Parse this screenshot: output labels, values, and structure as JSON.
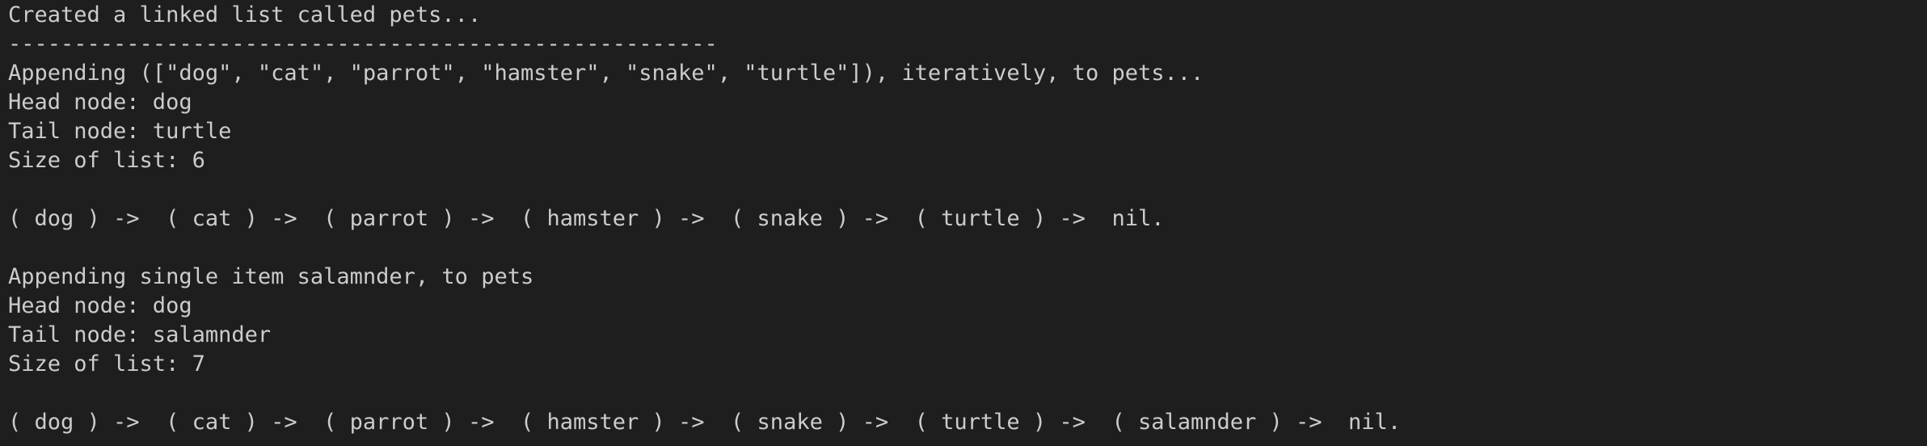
{
  "terminal": {
    "lines": [
      "Created a linked list called pets...",
      "------------------------------------------------------",
      "Appending ([\"dog\", \"cat\", \"parrot\", \"hamster\", \"snake\", \"turtle\"]), iteratively, to pets...",
      "Head node: dog",
      "Tail node: turtle",
      "Size of list: 6",
      "",
      "( dog ) ->  ( cat ) ->  ( parrot ) ->  ( hamster ) ->  ( snake ) ->  ( turtle ) ->  nil.",
      "",
      "Appending single item salamnder, to pets",
      "Head node: dog",
      "Tail node: salamnder",
      "Size of list: 7",
      "",
      "( dog ) ->  ( cat ) ->  ( parrot ) ->  ( hamster ) ->  ( snake ) ->  ( turtle ) ->  ( salamnder ) ->  nil."
    ]
  }
}
